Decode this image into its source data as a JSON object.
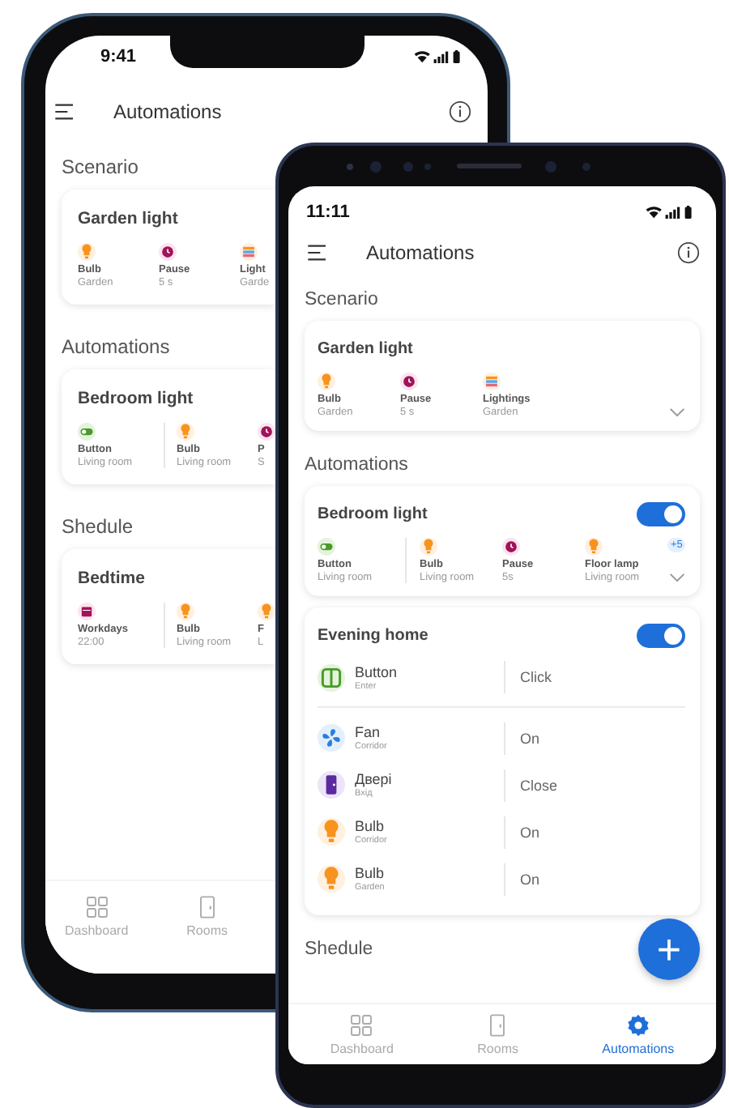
{
  "phones": [
    {
      "kind": "iphone",
      "status_bar": {
        "time": "9:41"
      },
      "header": {
        "title": "Automations"
      },
      "sections": [
        {
          "title": "Scenario",
          "cards": [
            {
              "kind": "summary",
              "title": "Garden light",
              "items": [
                {
                  "kind": "bulb",
                  "label": "Bulb",
                  "sublabel": "Garden",
                  "trigger": false
                },
                {
                  "kind": "pause",
                  "label": "Pause",
                  "sublabel": "5 s",
                  "trigger": false
                },
                {
                  "kind": "lightings",
                  "label": "Light",
                  "sublabel": "Garde",
                  "trigger": false
                }
              ]
            }
          ]
        },
        {
          "title": "Automations",
          "cards": [
            {
              "kind": "summary",
              "title": "Bedroom light",
              "items": [
                {
                  "kind": "switch",
                  "label": "Button",
                  "sublabel": "Living room",
                  "trigger": true
                },
                {
                  "kind": "bulb",
                  "label": "Bulb",
                  "sublabel": "Living room",
                  "trigger": false
                },
                {
                  "kind": "pause",
                  "label": "P",
                  "sublabel": "S",
                  "trigger": false
                }
              ]
            }
          ]
        },
        {
          "title": "Shedule",
          "cards": [
            {
              "kind": "summary",
              "title": "Bedtime",
              "items": [
                {
                  "kind": "calendar",
                  "label": "Workdays",
                  "sublabel": "22:00",
                  "trigger": true
                },
                {
                  "kind": "bulb",
                  "label": "Bulb",
                  "sublabel": "Living room",
                  "trigger": false
                },
                {
                  "kind": "bulb",
                  "label": "F",
                  "sublabel": "L",
                  "trigger": false
                }
              ]
            }
          ]
        }
      ],
      "nav": [
        {
          "kind": "grid",
          "label": "Dashboard",
          "selected": false
        },
        {
          "kind": "door",
          "label": "Rooms",
          "selected": false
        }
      ]
    },
    {
      "kind": "android",
      "status_bar": {
        "time": "11:11"
      },
      "header": {
        "title": "Automations"
      },
      "sections": [
        {
          "title": "Scenario",
          "cards": [
            {
              "kind": "summary",
              "title": "Garden light",
              "chevron": true,
              "items": [
                {
                  "kind": "bulb",
                  "label": "Bulb",
                  "sublabel": "Garden",
                  "trigger": false
                },
                {
                  "kind": "pause",
                  "label": "Pause",
                  "sublabel": "5 s",
                  "trigger": false
                },
                {
                  "kind": "lightings",
                  "label": "Lightings",
                  "sublabel": "Garden",
                  "trigger": false
                }
              ]
            }
          ]
        },
        {
          "title": "Automations",
          "cards": [
            {
              "kind": "summary",
              "title": "Bedroom light",
              "on": true,
              "chevron": true,
              "more": "+5",
              "items": [
                {
                  "kind": "switch",
                  "label": "Button",
                  "sublabel": "Living room",
                  "trigger": true
                },
                {
                  "kind": "bulb",
                  "label": "Bulb",
                  "sublabel": "Living room",
                  "trigger": false
                },
                {
                  "kind": "pause",
                  "label": "Pause",
                  "sublabel": "5s",
                  "trigger": false
                },
                {
                  "kind": "bulb",
                  "label": "Floor lamp",
                  "sublabel": "Living room",
                  "trigger": false
                }
              ]
            },
            {
              "kind": "detail",
              "title": "Evening home",
              "on": true,
              "rows": [
                {
                  "kind": "panel",
                  "label": "Button",
                  "sublabel": "Enter",
                  "value": "Click",
                  "trigger": true
                },
                {
                  "kind": "fan",
                  "label": "Fan",
                  "sublabel": "Corridor",
                  "value": "On",
                  "trigger": false
                },
                {
                  "kind": "door",
                  "label": "Двері",
                  "sublabel": "Вхід",
                  "value": "Close",
                  "trigger": false
                },
                {
                  "kind": "bulb",
                  "label": "Bulb",
                  "sublabel": "Corridor",
                  "value": "On",
                  "trigger": false
                },
                {
                  "kind": "bulb",
                  "label": "Bulb",
                  "sublabel": "Garden",
                  "value": "On",
                  "trigger": false
                }
              ]
            }
          ]
        },
        {
          "title": "Shedule"
        }
      ],
      "fab": {
        "label": "+"
      },
      "nav": [
        {
          "kind": "grid",
          "label": "Dashboard",
          "selected": false
        },
        {
          "kind": "door",
          "label": "Rooms",
          "selected": false
        },
        {
          "kind": "gear",
          "label": "Automations",
          "selected": true
        }
      ]
    }
  ]
}
